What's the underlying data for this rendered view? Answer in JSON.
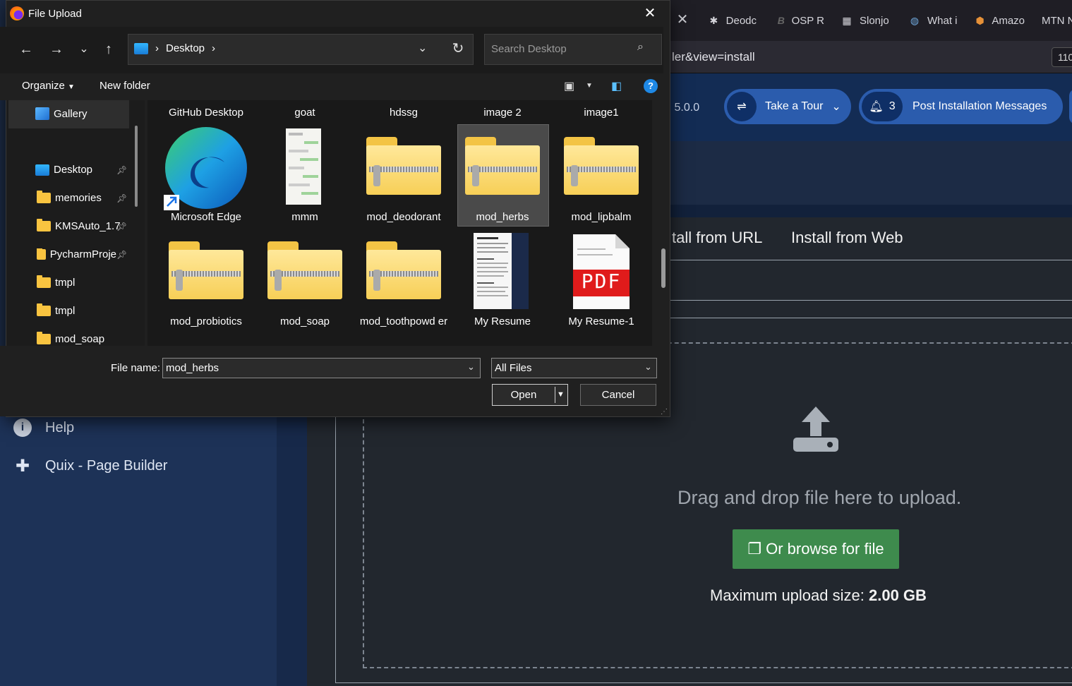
{
  "browser": {
    "tabs": [
      {
        "label": "Deodc",
        "icon": "joomla-icon"
      },
      {
        "label": "OSP R",
        "icon": "bold-b-icon"
      },
      {
        "label": "Slonjo",
        "icon": "server-icon"
      },
      {
        "label": "What i",
        "icon": "globe-icon"
      },
      {
        "label": "Amazo",
        "icon": "box-icon"
      },
      {
        "label": "MTN N",
        "icon": ""
      }
    ],
    "url_text": "ler&view=install",
    "url_badge": "110"
  },
  "joomla": {
    "version_text": "5.0.0",
    "take_tour": "Take a Tour",
    "notif_count": "3",
    "post_install": "Post Installation Messages",
    "tab_url": "tall from URL",
    "tab_web": "Install from Web",
    "drop_text": "Drag and drop file here to upload.",
    "browse_label": "Or browse for file",
    "max_upload_label": "Maximum upload size:",
    "max_upload_value": "2.00 GB",
    "sidebar": {
      "help": "Help",
      "quix": "Quix - Page Builder"
    }
  },
  "dialog": {
    "title": "File Upload",
    "breadcrumb": "Desktop",
    "search_placeholder": "Search Desktop",
    "organize": "Organize",
    "new_folder": "New folder",
    "nav_items": [
      {
        "label": "Gallery",
        "pinned": false
      },
      {
        "label": "Desktop",
        "pinned": true
      },
      {
        "label": "memories",
        "pinned": true
      },
      {
        "label": "KMSAuto_1.7",
        "pinned": true
      },
      {
        "label": "PycharmProje",
        "pinned": true
      },
      {
        "label": "tmpl",
        "pinned": false
      },
      {
        "label": "tmpl",
        "pinned": false
      },
      {
        "label": "mod_soap",
        "pinned": false
      }
    ],
    "files_row0": [
      "GitHub Desktop",
      "goat",
      "hdssg",
      "image 2",
      "image1"
    ],
    "files_row1": [
      "Microsoft Edge",
      "mmm",
      "mod_deodorant",
      "mod_herbs",
      "mod_lipbalm"
    ],
    "files_row2": [
      "mod_probiotics",
      "mod_soap",
      "mod_toothpowd er",
      "My Resume",
      "My Resume-1"
    ],
    "pdf_text": "PDF",
    "filename_label": "File name:",
    "filename_value": "mod_herbs",
    "filetype_value": "All Files",
    "open_label": "Open",
    "cancel_label": "Cancel"
  }
}
